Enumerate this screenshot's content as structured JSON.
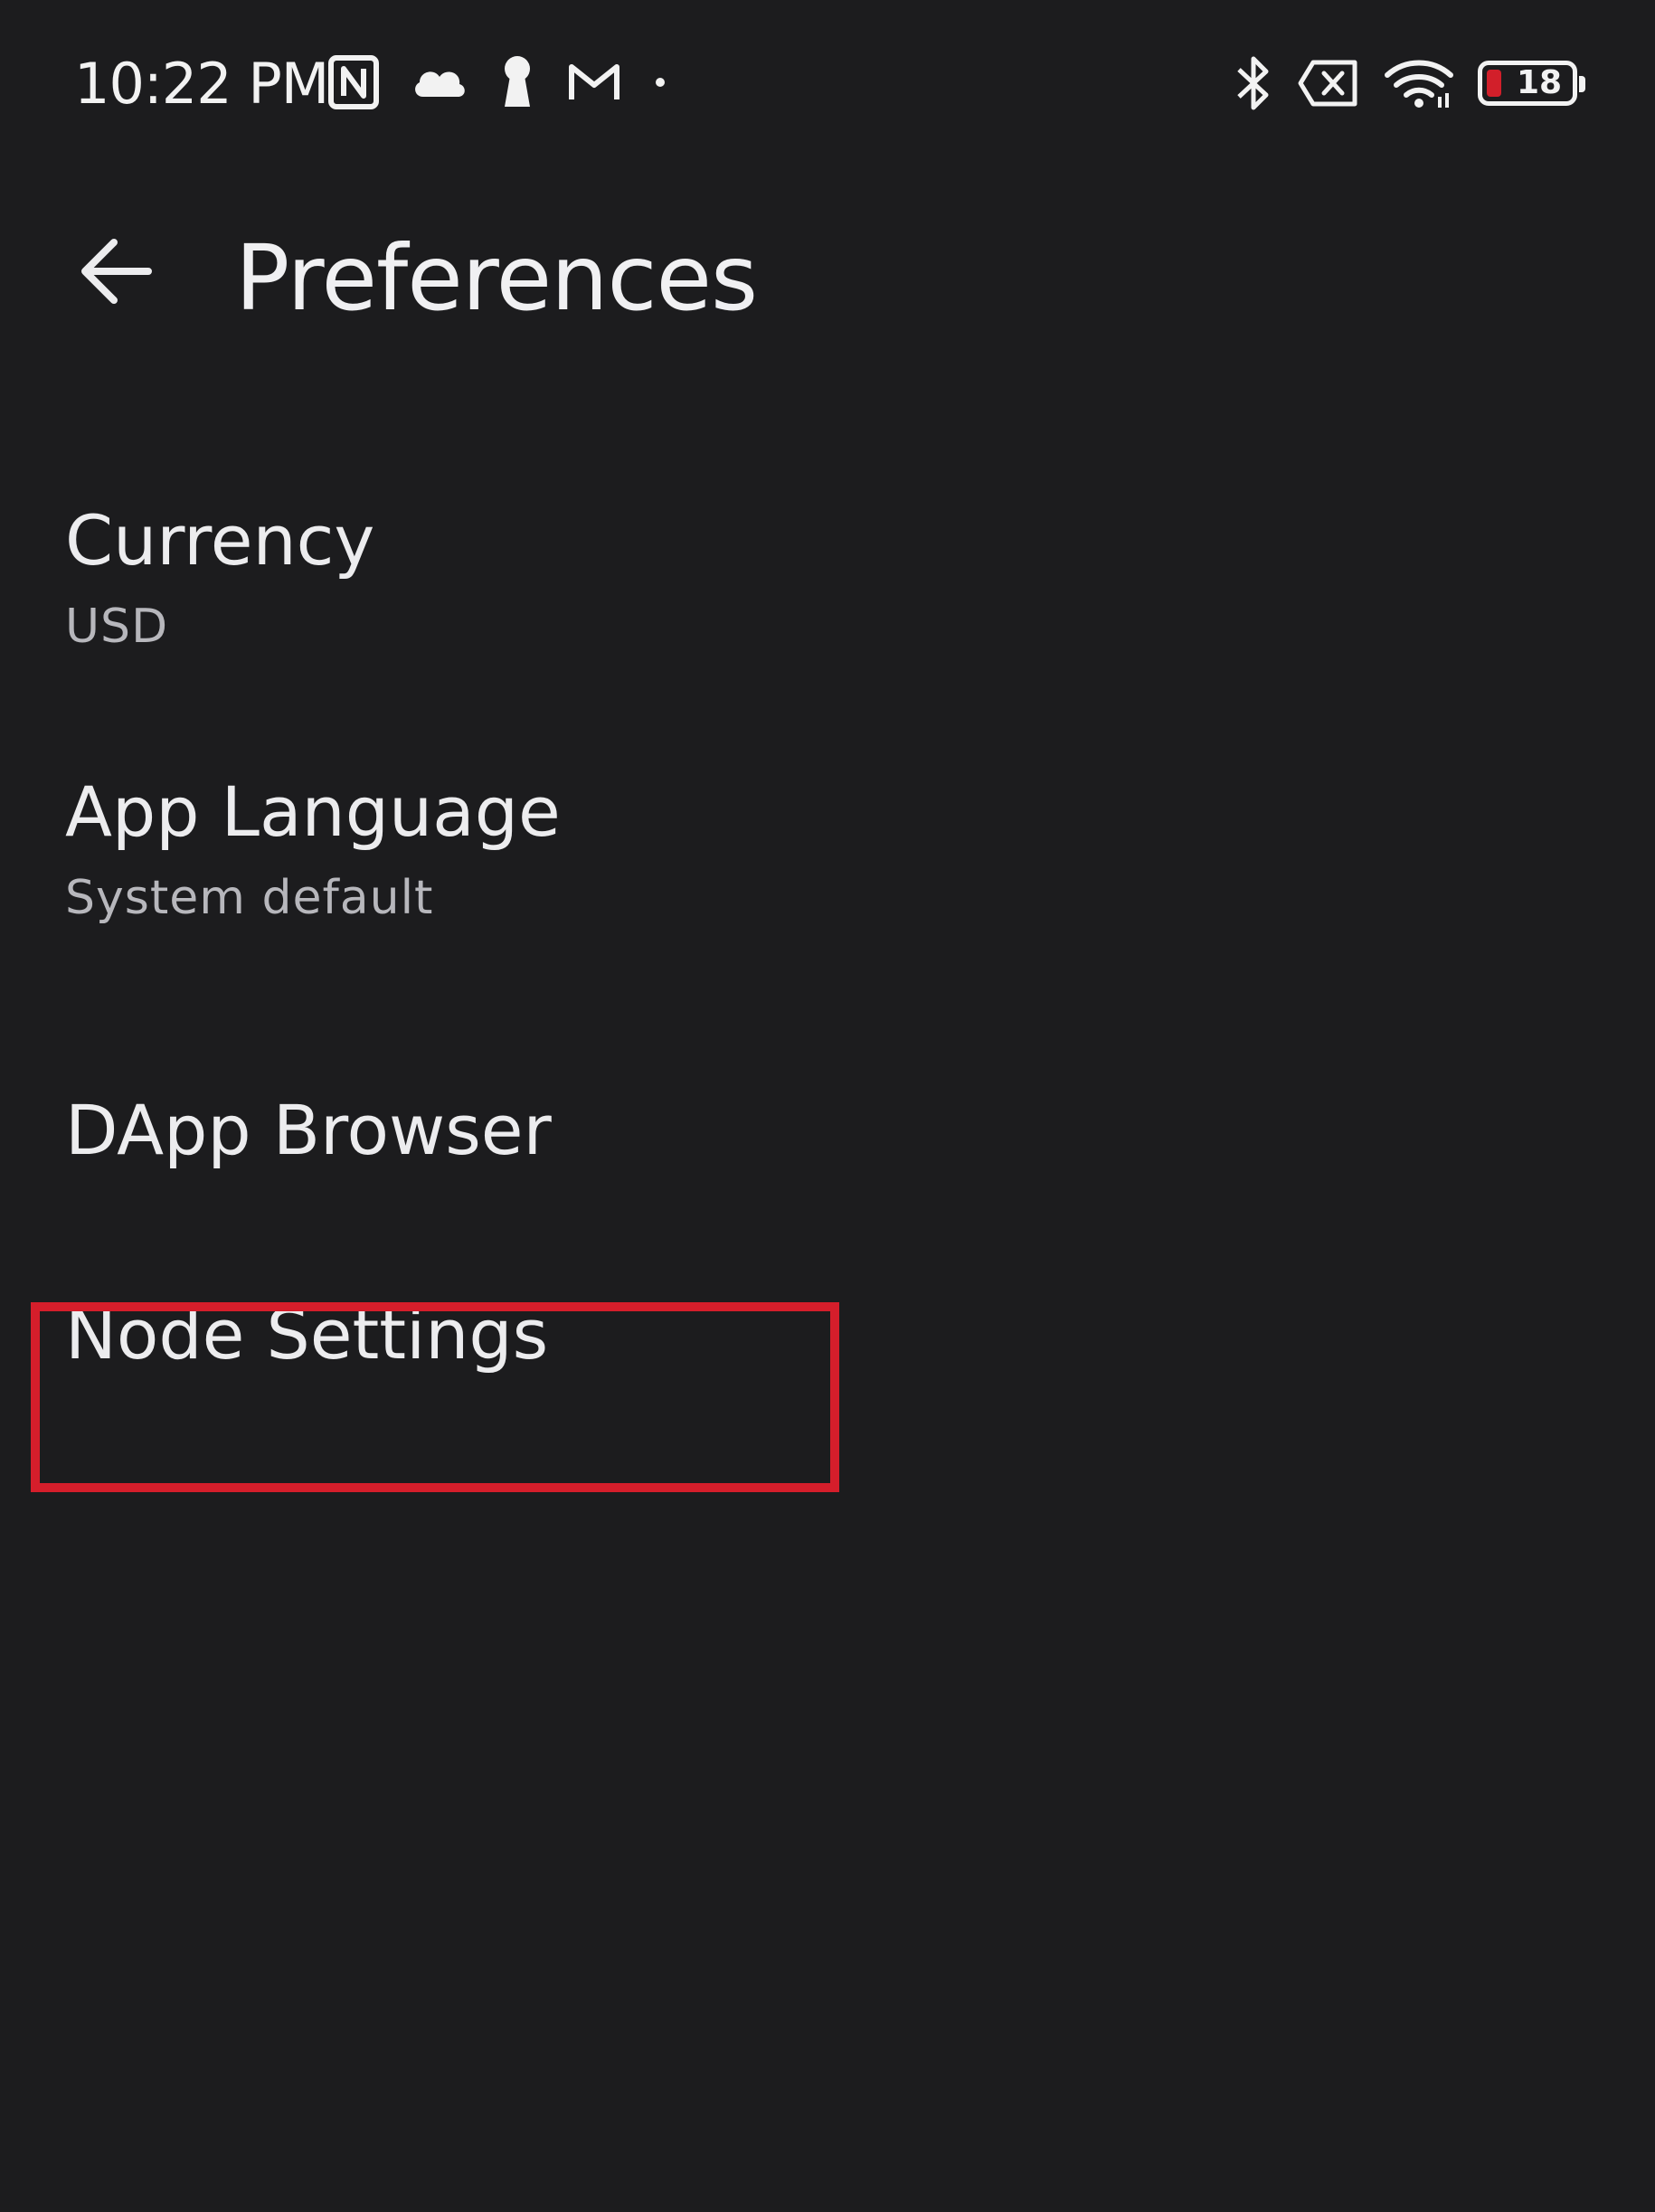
{
  "status_bar": {
    "time": "10:22 PM",
    "left_icons": [
      "nfc-icon",
      "cloud-icon",
      "keyhole-icon",
      "gmail-icon",
      "dot-icon"
    ],
    "right_icons": [
      "bluetooth-icon",
      "sim-x-icon",
      "wifi-icon",
      "battery-icon"
    ],
    "battery_level": "18",
    "battery_level_fraction": 0.18,
    "battery_low_color": "#d21f2a"
  },
  "app_bar": {
    "title": "Preferences",
    "back_icon": "arrow-back-icon"
  },
  "preferences": {
    "items": [
      {
        "title": "Currency",
        "summary": "USD"
      },
      {
        "title": "App Language",
        "summary": "System default"
      },
      {
        "title": "DApp Browser"
      },
      {
        "title": "Node Settings"
      }
    ]
  },
  "annotation": {
    "highlighted_item": "Node Settings",
    "color": "#d51e2b"
  },
  "colors": {
    "background": "#1c1c1e",
    "text_primary": "#ececee",
    "text_secondary": "#b7b7bc"
  }
}
